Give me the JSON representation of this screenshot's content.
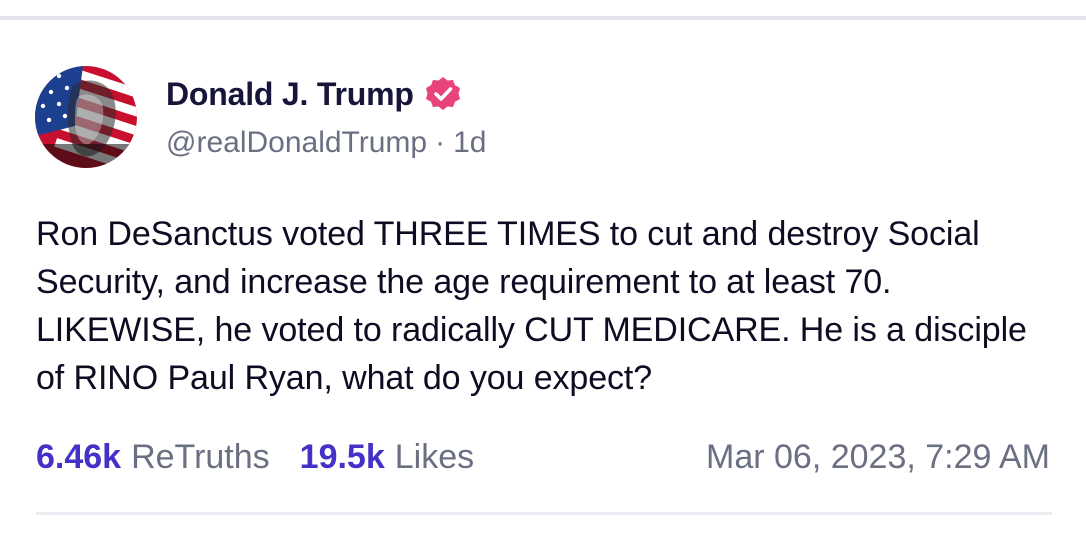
{
  "author": {
    "display_name": "Donald J. Trump",
    "handle": "@realDonaldTrump",
    "separator": "·",
    "age": "1d",
    "verified": true
  },
  "post": {
    "text": "Ron DeSanctus voted THREE TIMES to cut and destroy Social Security, and increase the age requirement to at least 70. LIKEWISE, he voted to radically CUT MEDICARE. He is a disciple of RINO Paul Ryan, what do you expect?"
  },
  "stats": {
    "retruths_count": "6.46k",
    "retruths_label": "ReTruths",
    "likes_count": "19.5k",
    "likes_label": "Likes"
  },
  "timestamp": "Mar 06, 2023, 7:29 AM",
  "colors": {
    "name": "#17163a",
    "muted": "#6b6f82",
    "accent": "#4431c8",
    "verified_badge": "#e8447a",
    "body": "#0d0c22"
  },
  "icons": {
    "verified": "verified-badge-icon",
    "avatar": "flag-portrait-avatar"
  }
}
